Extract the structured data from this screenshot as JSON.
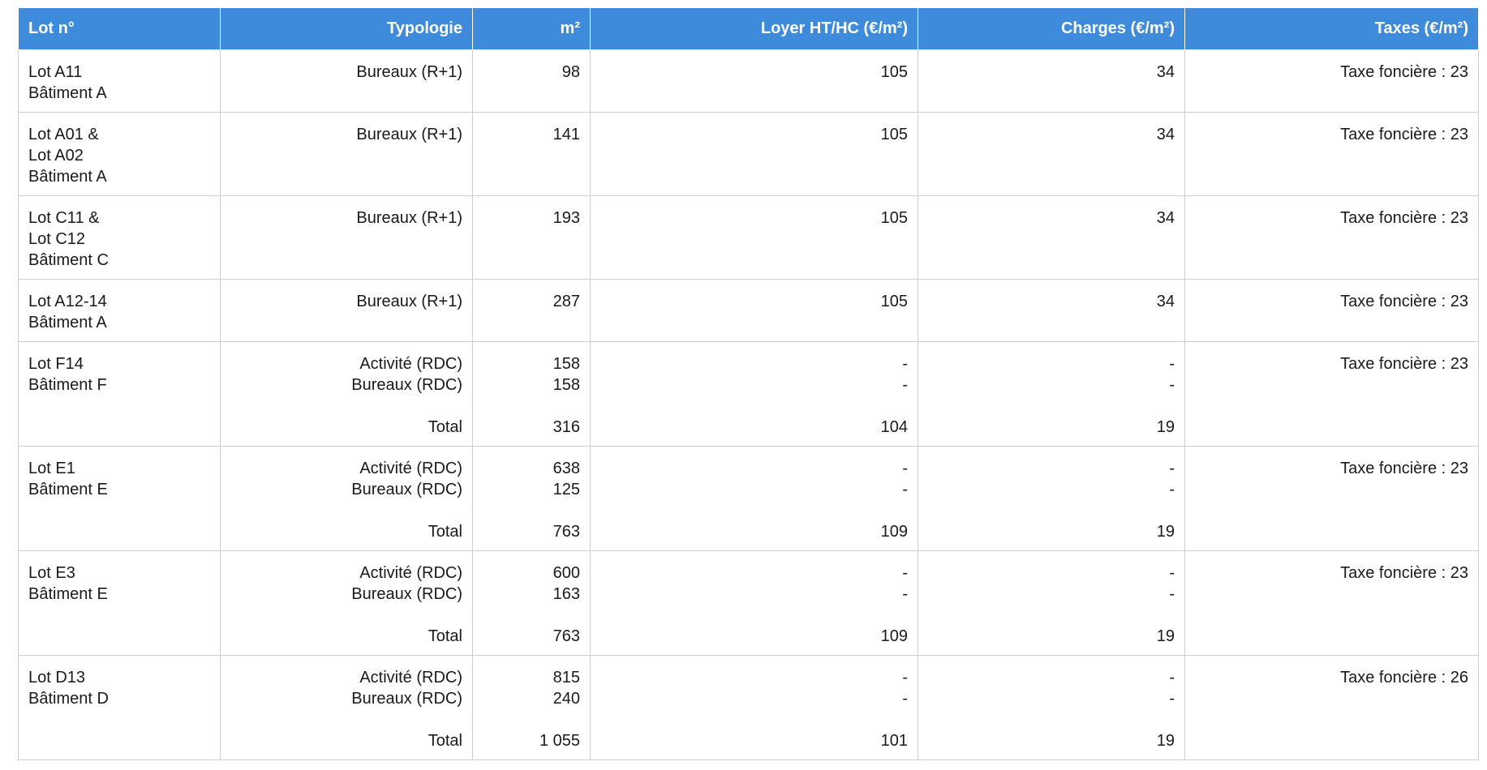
{
  "table": {
    "headers": [
      "Lot n°",
      "Typologie",
      "m²",
      "Loyer HT/HC (€/m²)",
      "Charges (€/m²)",
      "Taxes (€/m²)"
    ],
    "rows": [
      {
        "lot": [
          "Lot A11",
          "Bâtiment A"
        ],
        "typologie": [
          "Bureaux (R+1)"
        ],
        "m2": [
          "98"
        ],
        "loyer": [
          "105"
        ],
        "charges": [
          "34"
        ],
        "taxes": "Taxe foncière : 23"
      },
      {
        "lot": [
          "Lot A01 &",
          "Lot A02",
          "Bâtiment A"
        ],
        "typologie": [
          "Bureaux (R+1)"
        ],
        "m2": [
          "141"
        ],
        "loyer": [
          "105"
        ],
        "charges": [
          "34"
        ],
        "taxes": "Taxe foncière : 23"
      },
      {
        "lot": [
          "Lot C11 &",
          "Lot C12",
          "Bâtiment C"
        ],
        "typologie": [
          "Bureaux (R+1)"
        ],
        "m2": [
          "193"
        ],
        "loyer": [
          "105"
        ],
        "charges": [
          "34"
        ],
        "taxes": "Taxe foncière : 23"
      },
      {
        "lot": [
          "Lot A12-14",
          "Bâtiment A"
        ],
        "typologie": [
          "Bureaux (R+1)"
        ],
        "m2": [
          "287"
        ],
        "loyer": [
          "105"
        ],
        "charges": [
          "34"
        ],
        "taxes": "Taxe foncière : 23"
      },
      {
        "lot": [
          "Lot F14",
          "Bâtiment F"
        ],
        "typologie": [
          "Activité (RDC)",
          "Bureaux (RDC)",
          "",
          "Total"
        ],
        "m2": [
          "158",
          "158",
          "",
          "316"
        ],
        "loyer": [
          "-",
          "-",
          "",
          "104"
        ],
        "charges": [
          "-",
          "-",
          "",
          "19"
        ],
        "taxes": "Taxe foncière : 23"
      },
      {
        "lot": [
          "Lot E1",
          "Bâtiment E"
        ],
        "typologie": [
          "Activité (RDC)",
          "Bureaux (RDC)",
          "",
          "Total"
        ],
        "m2": [
          "638",
          "125",
          "",
          "763"
        ],
        "loyer": [
          "-",
          "-",
          "",
          "109"
        ],
        "charges": [
          "-",
          "-",
          "",
          "19"
        ],
        "taxes": "Taxe foncière : 23"
      },
      {
        "lot": [
          "Lot E3",
          "Bâtiment E"
        ],
        "typologie": [
          "Activité (RDC)",
          "Bureaux (RDC)",
          "",
          "Total"
        ],
        "m2": [
          "600",
          "163",
          "",
          "763"
        ],
        "loyer": [
          "-",
          "-",
          "",
          "109"
        ],
        "charges": [
          "-",
          "-",
          "",
          "19"
        ],
        "taxes": "Taxe foncière : 23"
      },
      {
        "lot": [
          "Lot D13",
          "Bâtiment D"
        ],
        "typologie": [
          "Activité (RDC)",
          "Bureaux (RDC)",
          "",
          "Total"
        ],
        "m2": [
          "815",
          "240",
          "",
          "1 055"
        ],
        "loyer": [
          "-",
          "-",
          "",
          "101"
        ],
        "charges": [
          "-",
          "-",
          "",
          "19"
        ],
        "taxes": "Taxe foncière : 26"
      }
    ]
  }
}
